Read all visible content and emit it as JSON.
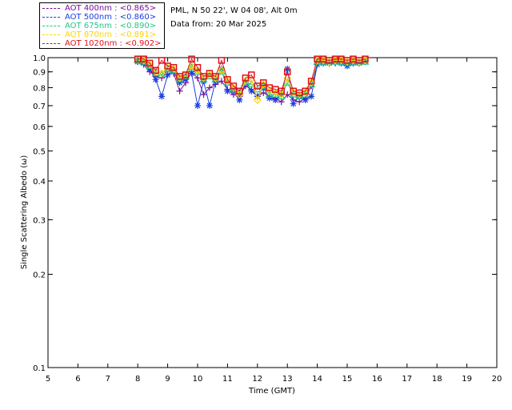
{
  "header": {
    "site": "PML, N 50 22', W 04 08', Alt 0m",
    "date": "Data from: 20 Mar 2025"
  },
  "chart_data": {
    "type": "line",
    "xlabel": "Time (GMT)",
    "ylabel": "Single Scattering Albedo (ω)",
    "xlim": [
      5,
      20
    ],
    "ylim": [
      0.1,
      1.0
    ],
    "yscale": "log",
    "xticks": [
      "5",
      "6",
      "7",
      "8",
      "9",
      "10",
      "11",
      "12",
      "13",
      "14",
      "15",
      "16",
      "17",
      "18",
      "19",
      "20"
    ],
    "yticks": [
      "0.1",
      "0.2",
      "0.3",
      "0.4",
      "0.5",
      "0.6",
      "0.7",
      "0.8",
      "0.9",
      "1.0"
    ],
    "legend_position": "top-left",
    "series": [
      {
        "name": "AOT  400nm : <0.865>",
        "color": "#7a0f9c",
        "marker": "plus",
        "x": [
          8.0,
          8.2,
          8.4,
          8.6,
          8.8,
          9.0,
          9.2,
          9.4,
          9.6,
          9.8,
          10.0,
          10.2,
          10.4,
          10.6,
          10.8,
          11.0,
          11.2,
          11.4,
          11.6,
          11.8,
          12.0,
          12.2,
          12.4,
          12.6,
          12.8,
          13.0,
          13.2,
          13.4,
          13.6,
          13.8,
          14.0,
          14.2,
          14.4,
          14.6,
          14.8,
          15.0,
          15.2,
          15.4,
          15.6
        ],
        "y": [
          0.97,
          0.95,
          0.9,
          0.87,
          0.86,
          0.91,
          0.89,
          0.78,
          0.83,
          0.9,
          0.86,
          0.76,
          0.8,
          0.82,
          0.84,
          0.79,
          0.76,
          0.75,
          0.81,
          0.79,
          0.75,
          0.77,
          0.75,
          0.74,
          0.72,
          0.76,
          0.73,
          0.72,
          0.74,
          0.81,
          0.95,
          0.96,
          0.96,
          0.96,
          0.96,
          0.95,
          0.96,
          0.96,
          0.97
        ]
      },
      {
        "name": "AOT  500nm : <0.860>",
        "color": "#1a3fe0",
        "marker": "star",
        "x": [
          8.0,
          8.2,
          8.4,
          8.6,
          8.8,
          9.0,
          9.2,
          9.4,
          9.6,
          9.8,
          10.0,
          10.2,
          10.4,
          10.6,
          10.8,
          11.0,
          11.2,
          11.4,
          11.6,
          11.8,
          12.0,
          12.2,
          12.4,
          12.6,
          12.8,
          13.0,
          13.2,
          13.4,
          13.6,
          13.8,
          14.0,
          14.2,
          14.4,
          14.6,
          14.8,
          15.0,
          15.2,
          15.4,
          15.6
        ],
        "y": [
          0.97,
          0.96,
          0.92,
          0.85,
          0.75,
          0.88,
          0.9,
          0.83,
          0.85,
          0.89,
          0.7,
          0.84,
          0.7,
          0.84,
          0.92,
          0.78,
          0.78,
          0.73,
          0.83,
          0.78,
          0.75,
          0.8,
          0.74,
          0.73,
          0.76,
          0.92,
          0.71,
          0.75,
          0.73,
          0.75,
          0.95,
          0.96,
          0.96,
          0.97,
          0.96,
          0.94,
          0.96,
          0.96,
          0.97
        ]
      },
      {
        "name": "AOT  675nm : <0.890>",
        "color": "#22c48a",
        "marker": "triangle",
        "x": [
          8.0,
          8.2,
          8.4,
          8.6,
          8.8,
          9.0,
          9.2,
          9.4,
          9.6,
          9.8,
          10.0,
          10.2,
          10.4,
          10.6,
          10.8,
          11.0,
          11.2,
          11.4,
          11.6,
          11.8,
          12.0,
          12.2,
          12.4,
          12.6,
          12.8,
          13.0,
          13.2,
          13.4,
          13.6,
          13.8,
          14.0,
          14.2,
          14.4,
          14.6,
          14.8,
          15.0,
          15.2,
          15.4,
          15.6
        ],
        "y": [
          0.98,
          0.97,
          0.94,
          0.89,
          0.88,
          0.92,
          0.91,
          0.85,
          0.87,
          0.93,
          0.9,
          0.85,
          0.87,
          0.85,
          0.9,
          0.83,
          0.79,
          0.77,
          0.83,
          0.82,
          0.79,
          0.81,
          0.76,
          0.76,
          0.75,
          0.83,
          0.76,
          0.75,
          0.76,
          0.82,
          0.97,
          0.97,
          0.97,
          0.97,
          0.97,
          0.96,
          0.97,
          0.97,
          0.97
        ]
      },
      {
        "name": "AOT  870nm : <0.891>",
        "color": "#ffd400",
        "marker": "diamond",
        "x": [
          8.0,
          8.2,
          8.4,
          8.6,
          8.8,
          9.0,
          9.2,
          9.4,
          9.6,
          9.8,
          10.0,
          10.2,
          10.4,
          10.6,
          10.8,
          11.0,
          11.2,
          11.4,
          11.6,
          11.8,
          12.0,
          12.2,
          12.4,
          12.6,
          12.8,
          13.0,
          13.2,
          13.4,
          13.6,
          13.8,
          14.0,
          14.2,
          14.4,
          14.6,
          14.8,
          15.0,
          15.2,
          15.4,
          15.6
        ],
        "y": [
          0.99,
          0.98,
          0.95,
          0.9,
          0.89,
          0.93,
          0.92,
          0.86,
          0.88,
          0.94,
          0.91,
          0.86,
          0.88,
          0.86,
          0.91,
          0.84,
          0.8,
          0.76,
          0.84,
          0.85,
          0.73,
          0.82,
          0.78,
          0.77,
          0.76,
          0.86,
          0.77,
          0.76,
          0.77,
          0.83,
          0.98,
          0.98,
          0.97,
          0.98,
          0.98,
          0.97,
          0.98,
          0.97,
          0.98
        ]
      },
      {
        "name": "AOT 1020nm : <0.902>",
        "color": "#e0101c",
        "marker": "square",
        "x": [
          8.0,
          8.2,
          8.4,
          8.6,
          8.8,
          9.0,
          9.2,
          9.4,
          9.6,
          9.8,
          10.0,
          10.2,
          10.4,
          10.6,
          10.8,
          11.0,
          11.2,
          11.4,
          11.6,
          11.8,
          12.0,
          12.2,
          12.4,
          12.6,
          12.8,
          13.0,
          13.2,
          13.4,
          13.6,
          13.8,
          14.0,
          14.2,
          14.4,
          14.6,
          14.8,
          15.0,
          15.2,
          15.4,
          15.6
        ],
        "y": [
          0.99,
          0.99,
          0.96,
          0.91,
          0.98,
          0.94,
          0.93,
          0.87,
          0.88,
          0.99,
          0.93,
          0.87,
          0.89,
          0.87,
          0.98,
          0.85,
          0.81,
          0.78,
          0.86,
          0.88,
          0.81,
          0.83,
          0.8,
          0.79,
          0.78,
          0.9,
          0.78,
          0.77,
          0.78,
          0.84,
          0.99,
          0.99,
          0.98,
          0.99,
          0.99,
          0.98,
          0.99,
          0.98,
          0.99
        ]
      }
    ]
  }
}
